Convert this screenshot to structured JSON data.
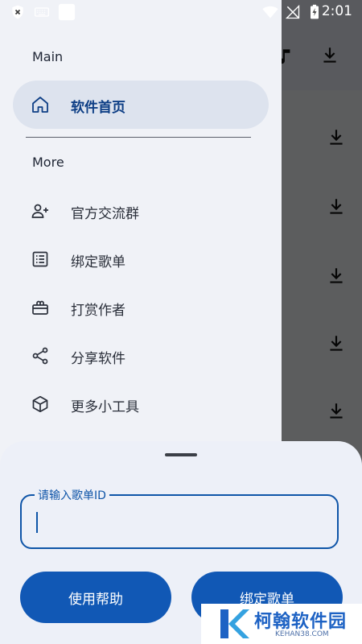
{
  "status_bar": {
    "time": "2:01",
    "icons": [
      "shield-x-icon",
      "keyboard-icon",
      "app-square-icon",
      "wifi-icon",
      "no-signal-icon",
      "battery-charging-icon"
    ]
  },
  "background_app": {
    "icons": [
      "music-icon",
      "download-icon"
    ]
  },
  "drawer": {
    "section_main": "Main",
    "section_more": "More",
    "items": [
      {
        "label": "软件首页",
        "icon": "home-icon",
        "active": true
      },
      {
        "label": "官方交流群",
        "icon": "add-group-icon"
      },
      {
        "label": "绑定歌单",
        "icon": "list-icon"
      },
      {
        "label": "打赏作者",
        "icon": "gift-icon"
      },
      {
        "label": "分享软件",
        "icon": "share-icon"
      },
      {
        "label": "更多小工具",
        "icon": "cube-icon"
      }
    ]
  },
  "sheet": {
    "input_label": "请输入歌单ID",
    "input_value": "",
    "help_button": "使用帮助",
    "bind_button": "绑定歌单"
  },
  "watermark": {
    "text": "柯翰软件园",
    "sub": "KEHAN38.COM"
  },
  "colors": {
    "accent": "#1158b5",
    "drawer_bg": "#f0f2f7",
    "active_item_bg": "#dde3ee"
  }
}
